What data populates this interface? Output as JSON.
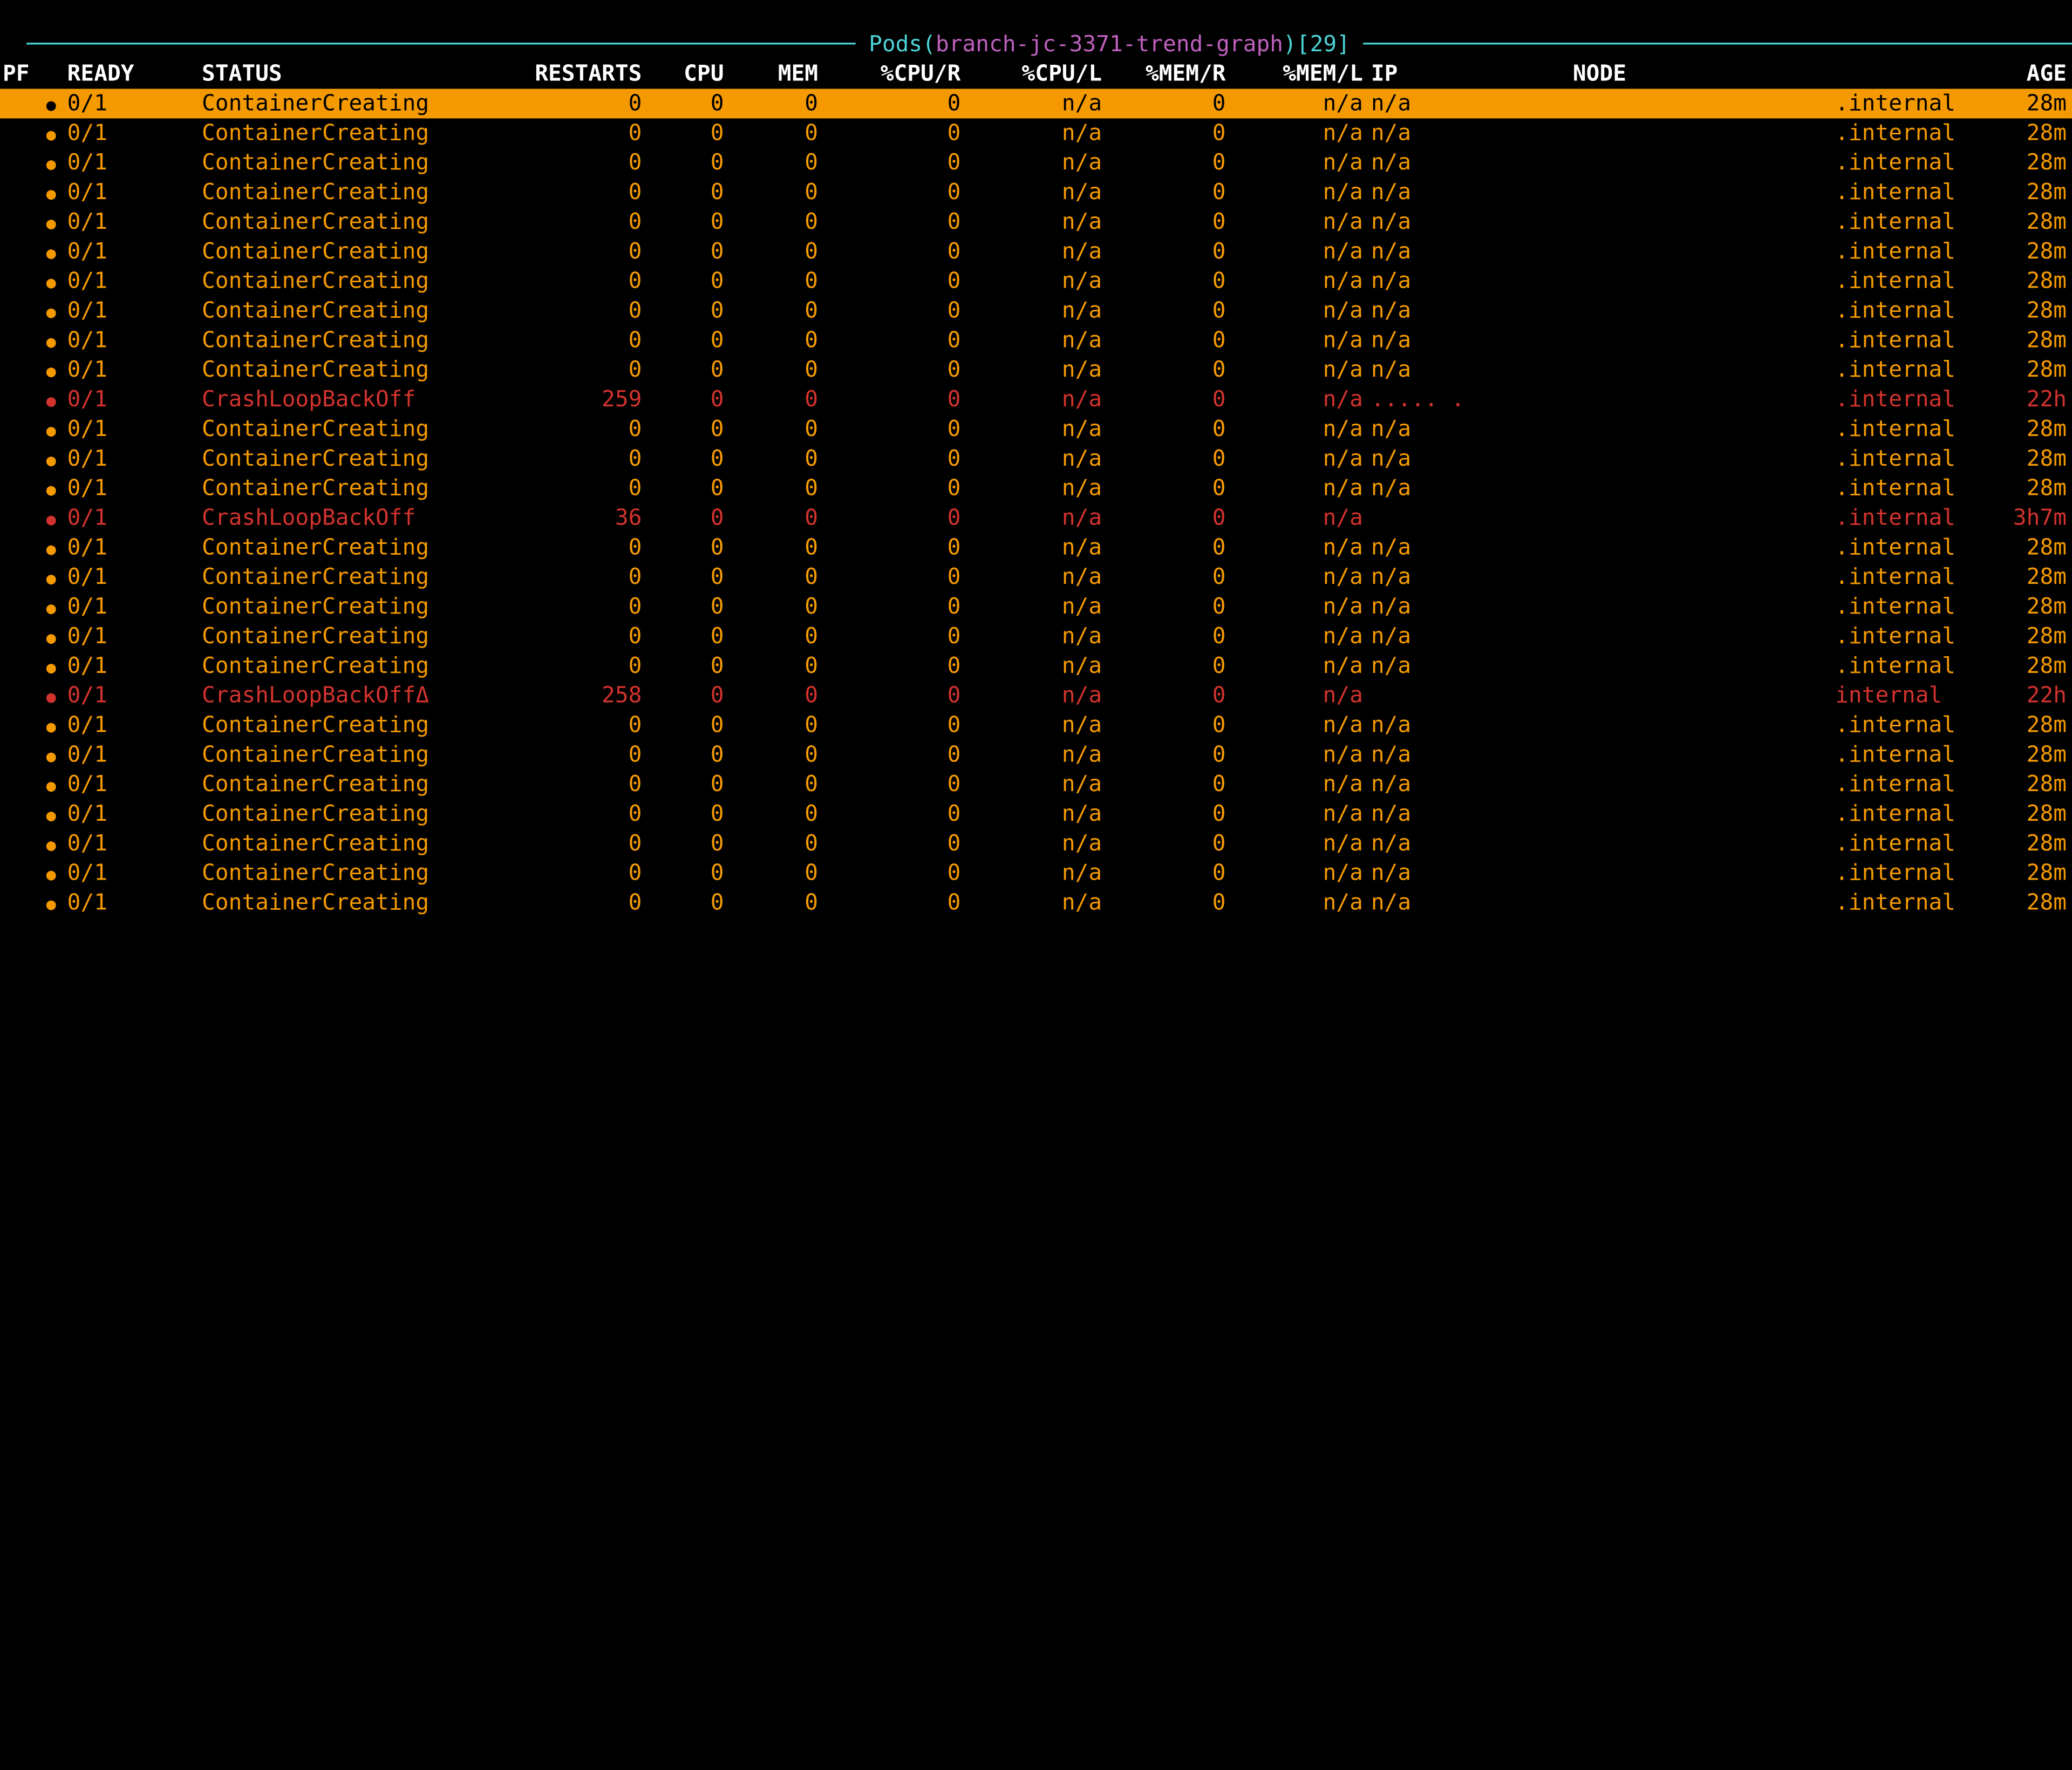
{
  "title": {
    "left_dash": "────────────────────────────────────────────────────────────── ",
    "word": "Pods",
    "open": "(",
    "context": "branch-jc-3371-trend-graph",
    "close": ")",
    "count_open": "[",
    "count": "29",
    "count_close": "]",
    "right_dash": " ──────────────────────────────────────────────────────────────"
  },
  "columns": {
    "pf": "PF",
    "ready": "READY",
    "status": "STATUS",
    "restarts": "RESTARTS",
    "cpu": "CPU",
    "mem": "MEM",
    "cpur": "%CPU/R",
    "cpul": "%CPU/L",
    "memr": "%MEM/R",
    "meml": "%MEM/L",
    "ip": "IP",
    "node": "NODE",
    "age": "AGE"
  },
  "rows": [
    {
      "sel": true,
      "dot": "orange",
      "ready": "0/1",
      "status": "ContainerCreating",
      "restarts": "0",
      "cpu": "0",
      "mem": "0",
      "cpur": "0",
      "cpul": "n/a",
      "memr": "0",
      "meml": "n/a",
      "ip": "n/a",
      "node": ".internal",
      "age": "28m",
      "color": "orange"
    },
    {
      "dot": "orange",
      "ready": "0/1",
      "status": "ContainerCreating",
      "restarts": "0",
      "cpu": "0",
      "mem": "0",
      "cpur": "0",
      "cpul": "n/a",
      "memr": "0",
      "meml": "n/a",
      "ip": "n/a",
      "node": ".internal",
      "age": "28m",
      "color": "orange"
    },
    {
      "dot": "orange",
      "ready": "0/1",
      "status": "ContainerCreating",
      "restarts": "0",
      "cpu": "0",
      "mem": "0",
      "cpur": "0",
      "cpul": "n/a",
      "memr": "0",
      "meml": "n/a",
      "ip": "n/a",
      "node": ".internal",
      "age": "28m",
      "color": "orange"
    },
    {
      "dot": "orange",
      "ready": "0/1",
      "status": "ContainerCreating",
      "restarts": "0",
      "cpu": "0",
      "mem": "0",
      "cpur": "0",
      "cpul": "n/a",
      "memr": "0",
      "meml": "n/a",
      "ip": "n/a",
      "node": ".internal",
      "age": "28m",
      "color": "orange"
    },
    {
      "dot": "orange",
      "ready": "0/1",
      "status": "ContainerCreating",
      "restarts": "0",
      "cpu": "0",
      "mem": "0",
      "cpur": "0",
      "cpul": "n/a",
      "memr": "0",
      "meml": "n/a",
      "ip": "n/a",
      "node": ".internal",
      "age": "28m",
      "color": "orange"
    },
    {
      "dot": "orange",
      "ready": "0/1",
      "status": "ContainerCreating",
      "restarts": "0",
      "cpu": "0",
      "mem": "0",
      "cpur": "0",
      "cpul": "n/a",
      "memr": "0",
      "meml": "n/a",
      "ip": "n/a",
      "node": ".internal",
      "age": "28m",
      "color": "orange"
    },
    {
      "dot": "orange",
      "ready": "0/1",
      "status": "ContainerCreating",
      "restarts": "0",
      "cpu": "0",
      "mem": "0",
      "cpur": "0",
      "cpul": "n/a",
      "memr": "0",
      "meml": "n/a",
      "ip": "n/a",
      "node": ".internal",
      "age": "28m",
      "color": "orange"
    },
    {
      "dot": "orange",
      "ready": "0/1",
      "status": "ContainerCreating",
      "restarts": "0",
      "cpu": "0",
      "mem": "0",
      "cpur": "0",
      "cpul": "n/a",
      "memr": "0",
      "meml": "n/a",
      "ip": "n/a",
      "node": ".internal",
      "age": "28m",
      "color": "orange"
    },
    {
      "dot": "orange",
      "ready": "0/1",
      "status": "ContainerCreating",
      "restarts": "0",
      "cpu": "0",
      "mem": "0",
      "cpur": "0",
      "cpul": "n/a",
      "memr": "0",
      "meml": "n/a",
      "ip": "n/a",
      "node": ".internal",
      "age": "28m",
      "color": "orange"
    },
    {
      "dot": "orange",
      "ready": "0/1",
      "status": "ContainerCreating",
      "restarts": "0",
      "cpu": "0",
      "mem": "0",
      "cpur": "0",
      "cpul": "n/a",
      "memr": "0",
      "meml": "n/a",
      "ip": "n/a",
      "node": ".internal",
      "age": "28m",
      "color": "orange"
    },
    {
      "dot": "red",
      "ready": "0/1",
      "status": "CrashLoopBackOff",
      "restarts": "259",
      "cpu": "0",
      "mem": "0",
      "cpur": "0",
      "cpul": "n/a",
      "memr": "0",
      "meml": "n/a",
      "ip": "..... .",
      "node": ".internal",
      "age": "22h",
      "color": "red"
    },
    {
      "dot": "orange",
      "ready": "0/1",
      "status": "ContainerCreating",
      "restarts": "0",
      "cpu": "0",
      "mem": "0",
      "cpur": "0",
      "cpul": "n/a",
      "memr": "0",
      "meml": "n/a",
      "ip": "n/a",
      "node": ".internal",
      "age": "28m",
      "color": "orange"
    },
    {
      "dot": "orange",
      "ready": "0/1",
      "status": "ContainerCreating",
      "restarts": "0",
      "cpu": "0",
      "mem": "0",
      "cpur": "0",
      "cpul": "n/a",
      "memr": "0",
      "meml": "n/a",
      "ip": "n/a",
      "node": ".internal",
      "age": "28m",
      "color": "orange"
    },
    {
      "dot": "orange",
      "ready": "0/1",
      "status": "ContainerCreating",
      "restarts": "0",
      "cpu": "0",
      "mem": "0",
      "cpur": "0",
      "cpul": "n/a",
      "memr": "0",
      "meml": "n/a",
      "ip": "n/a",
      "node": ".internal",
      "age": "28m",
      "color": "orange"
    },
    {
      "dot": "red",
      "ready": "0/1",
      "status": "CrashLoopBackOff",
      "restarts": "36",
      "cpu": "0",
      "mem": "0",
      "cpur": "0",
      "cpul": "n/a",
      "memr": "0",
      "meml": "n/a",
      "ip": "",
      "node": ".internal",
      "age": "3h7m",
      "color": "red"
    },
    {
      "dot": "orange",
      "ready": "0/1",
      "status": "ContainerCreating",
      "restarts": "0",
      "cpu": "0",
      "mem": "0",
      "cpur": "0",
      "cpul": "n/a",
      "memr": "0",
      "meml": "n/a",
      "ip": "n/a",
      "node": ".internal",
      "age": "28m",
      "color": "orange"
    },
    {
      "dot": "orange",
      "ready": "0/1",
      "status": "ContainerCreating",
      "restarts": "0",
      "cpu": "0",
      "mem": "0",
      "cpur": "0",
      "cpul": "n/a",
      "memr": "0",
      "meml": "n/a",
      "ip": "n/a",
      "node": ".internal",
      "age": "28m",
      "color": "orange"
    },
    {
      "dot": "orange",
      "ready": "0/1",
      "status": "ContainerCreating",
      "restarts": "0",
      "cpu": "0",
      "mem": "0",
      "cpur": "0",
      "cpul": "n/a",
      "memr": "0",
      "meml": "n/a",
      "ip": "n/a",
      "node": ".internal",
      "age": "28m",
      "color": "orange"
    },
    {
      "dot": "orange",
      "ready": "0/1",
      "status": "ContainerCreating",
      "restarts": "0",
      "cpu": "0",
      "mem": "0",
      "cpur": "0",
      "cpul": "n/a",
      "memr": "0",
      "meml": "n/a",
      "ip": "n/a",
      "node": ".internal",
      "age": "28m",
      "color": "orange"
    },
    {
      "dot": "orange",
      "ready": "0/1",
      "status": "ContainerCreating",
      "restarts": "0",
      "cpu": "0",
      "mem": "0",
      "cpur": "0",
      "cpul": "n/a",
      "memr": "0",
      "meml": "n/a",
      "ip": "n/a",
      "node": ".internal",
      "age": "28m",
      "color": "orange"
    },
    {
      "dot": "red",
      "ready": "0/1",
      "status": "CrashLoopBackOffΔ",
      "restarts": "258",
      "cpu": "0",
      "mem": "0",
      "cpur": "0",
      "cpul": "n/a",
      "memr": "0",
      "meml": "n/a",
      "ip": "",
      "node": "internal",
      "age": "22h",
      "color": "red"
    },
    {
      "dot": "orange",
      "ready": "0/1",
      "status": "ContainerCreating",
      "restarts": "0",
      "cpu": "0",
      "mem": "0",
      "cpur": "0",
      "cpul": "n/a",
      "memr": "0",
      "meml": "n/a",
      "ip": "n/a",
      "node": ".internal",
      "age": "28m",
      "color": "orange"
    },
    {
      "dot": "orange",
      "ready": "0/1",
      "status": "ContainerCreating",
      "restarts": "0",
      "cpu": "0",
      "mem": "0",
      "cpur": "0",
      "cpul": "n/a",
      "memr": "0",
      "meml": "n/a",
      "ip": "n/a",
      "node": ".internal",
      "age": "28m",
      "color": "orange"
    },
    {
      "dot": "orange",
      "ready": "0/1",
      "status": "ContainerCreating",
      "restarts": "0",
      "cpu": "0",
      "mem": "0",
      "cpur": "0",
      "cpul": "n/a",
      "memr": "0",
      "meml": "n/a",
      "ip": "n/a",
      "node": ".internal",
      "age": "28m",
      "color": "orange"
    },
    {
      "dot": "orange",
      "ready": "0/1",
      "status": "ContainerCreating",
      "restarts": "0",
      "cpu": "0",
      "mem": "0",
      "cpur": "0",
      "cpul": "n/a",
      "memr": "0",
      "meml": "n/a",
      "ip": "n/a",
      "node": ".internal",
      "age": "28m",
      "color": "orange"
    },
    {
      "dot": "orange",
      "ready": "0/1",
      "status": "ContainerCreating",
      "restarts": "0",
      "cpu": "0",
      "mem": "0",
      "cpur": "0",
      "cpul": "n/a",
      "memr": "0",
      "meml": "n/a",
      "ip": "n/a",
      "node": ".internal",
      "age": "28m",
      "color": "orange"
    },
    {
      "dot": "orange",
      "ready": "0/1",
      "status": "ContainerCreating",
      "restarts": "0",
      "cpu": "0",
      "mem": "0",
      "cpur": "0",
      "cpul": "n/a",
      "memr": "0",
      "meml": "n/a",
      "ip": "n/a",
      "node": ".internal",
      "age": "28m",
      "color": "orange"
    },
    {
      "dot": "orange",
      "ready": "0/1",
      "status": "ContainerCreating",
      "restarts": "0",
      "cpu": "0",
      "mem": "0",
      "cpur": "0",
      "cpul": "n/a",
      "memr": "0",
      "meml": "n/a",
      "ip": "n/a",
      "node": ".internal",
      "age": "28m",
      "color": "orange"
    }
  ]
}
